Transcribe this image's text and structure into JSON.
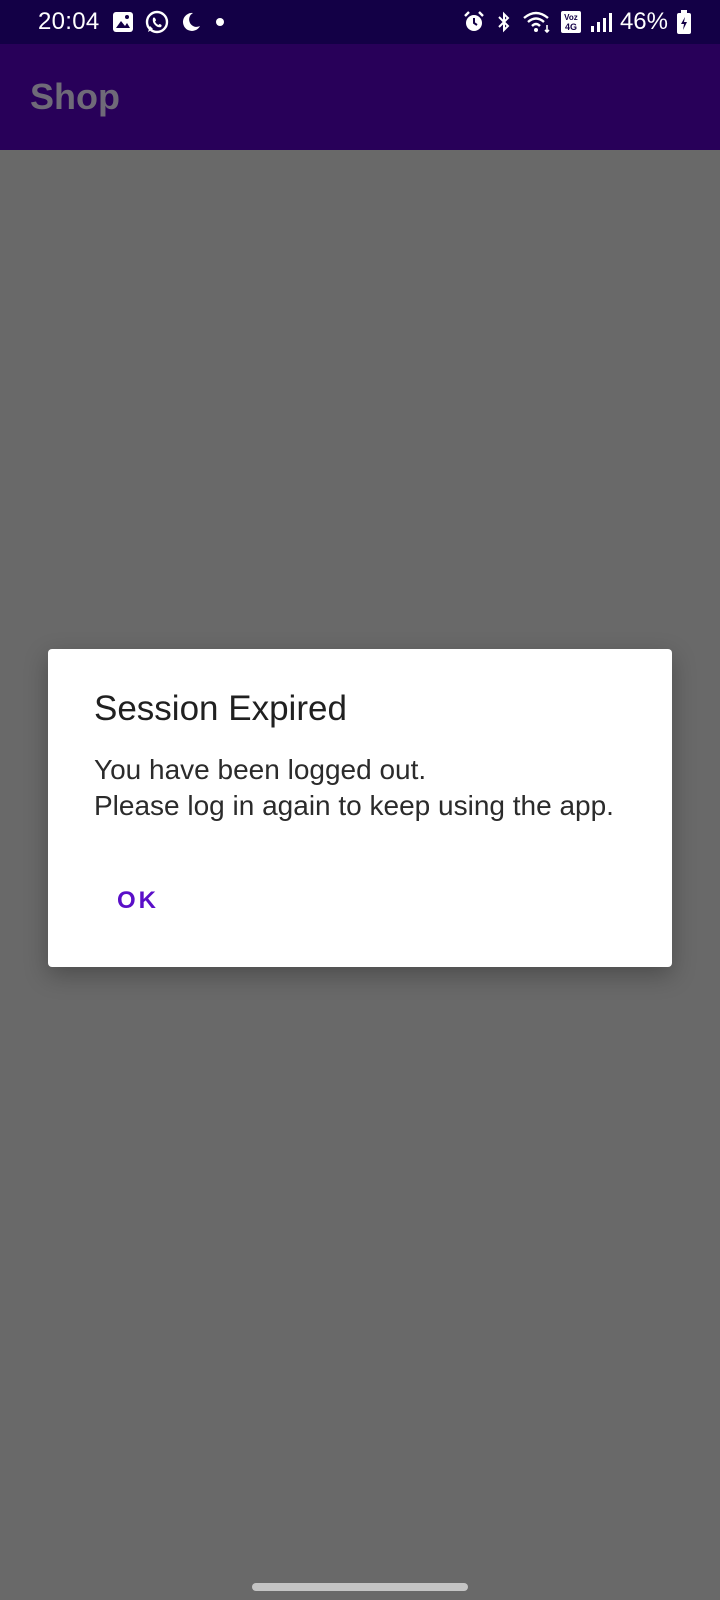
{
  "status_bar": {
    "time": "20:04",
    "battery_percent": "46%",
    "network_label": "Voz 4G",
    "left_icons": [
      "gallery-icon",
      "whatsapp-icon",
      "moon-icon",
      "dot-icon"
    ],
    "right_icons": [
      "alarm-icon",
      "bluetooth-icon",
      "wifi-icon",
      "volte-icon",
      "signal-icon",
      "battery-icon"
    ]
  },
  "app_bar": {
    "title": "Shop"
  },
  "dialog": {
    "title": "Session Expired",
    "message": "You have been logged out.\nPlease log in again to keep using the app.",
    "ok_label": "OK"
  },
  "colors": {
    "status_bar": "#130046",
    "app_bar": "#280059",
    "scrim": "#696969",
    "accent": "#5a0fc8"
  }
}
